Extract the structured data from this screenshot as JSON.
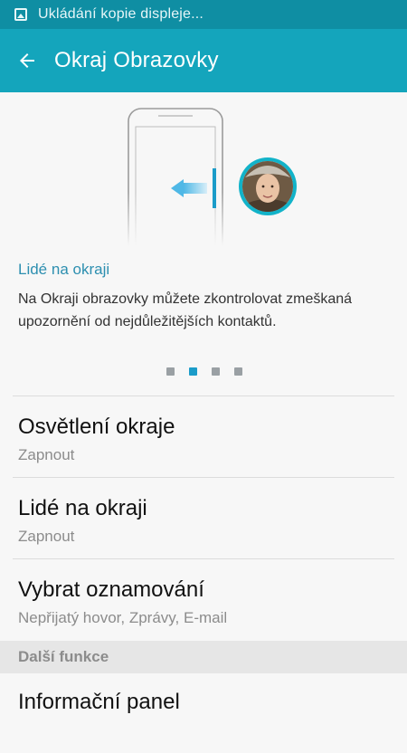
{
  "status_bar": {
    "notification": "Ukládání kopie displeje...",
    "icon": "image-icon"
  },
  "app_bar": {
    "title": "Okraj Obrazovky",
    "back_icon": "arrow-left-icon"
  },
  "intro": {
    "title": "Lidé na okraji",
    "description": "Na Okraji obrazovky můžete zkontrolovat zmeškaná upozornění od nejdůležitějších kontaktů."
  },
  "pager": {
    "total": 4,
    "active_index": 1
  },
  "settings": [
    {
      "title": "Osvětlení okraje",
      "subtitle": "Zapnout"
    },
    {
      "title": "Lidé na okraji",
      "subtitle": "Zapnout"
    },
    {
      "title": "Vybrat oznamování",
      "subtitle": "Nepřijatý hovor, Zprávy, E-mail"
    }
  ],
  "more_section": {
    "label": "Další funkce",
    "items": [
      {
        "title": "Informační panel"
      }
    ]
  },
  "colors": {
    "status_bar": "#0f8ea3",
    "app_bar": "#14a5bc",
    "accent": "#2d8fb0",
    "active_dot": "#1b9cc9"
  }
}
